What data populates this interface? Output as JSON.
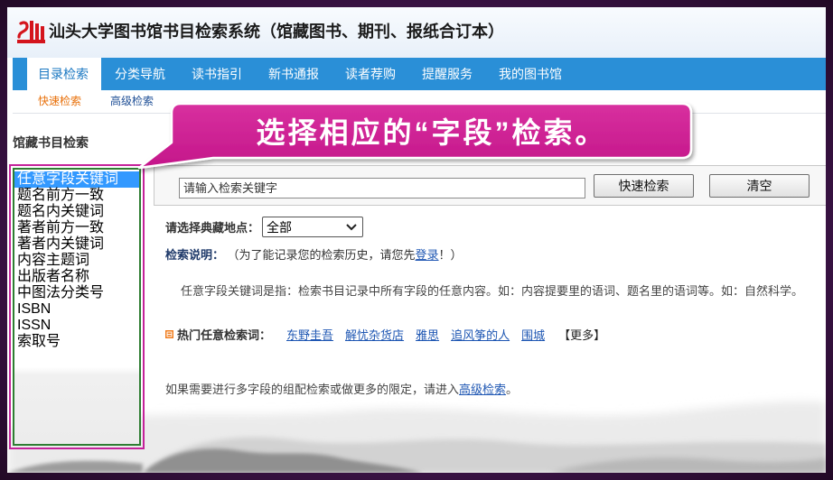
{
  "colors": {
    "frame_bg": "#3b1346",
    "nav_bg": "#2a8fd7",
    "tab_active_text": "#1b78c2",
    "accent_orange": "#e8700a",
    "link_blue": "#1f57b3",
    "callout_fill": "#c4168a",
    "highlight_border": "#c4229a",
    "list_border": "#2e7d32",
    "list_selected": "#3399ff"
  },
  "icons": {
    "logo": "shantou-university-logo",
    "select_arrow": "chevron-down-icon",
    "hot_bullet": "square-bullet-icon"
  },
  "header": {
    "title": "汕头大学图书馆书目检索系统（馆藏图书、期刊、报纸合订本）"
  },
  "nav": {
    "items": [
      {
        "label": "目录检索",
        "active": true
      },
      {
        "label": "分类导航",
        "active": false
      },
      {
        "label": "读书指引",
        "active": false
      },
      {
        "label": "新书通报",
        "active": false
      },
      {
        "label": "读者荐购",
        "active": false
      },
      {
        "label": "提醒服务",
        "active": false
      },
      {
        "label": "我的图书馆",
        "active": false
      }
    ]
  },
  "subnav": {
    "items": [
      {
        "label": "快速检索",
        "active": true
      },
      {
        "label": "高级检索",
        "active": false
      }
    ]
  },
  "sidebar": {
    "title": "馆藏书目检索",
    "selected_index": 0,
    "fields": [
      "任意字段关键词",
      "题名前方一致",
      "题名内关键词",
      "著者前方一致",
      "著者内关键词",
      "内容主题词",
      "出版者名称",
      "中图法分类号",
      "ISBN",
      "ISSN",
      "索取号"
    ]
  },
  "callout": {
    "text": "选择相应的“字段”检索。"
  },
  "search": {
    "placeholder": "请输入检索关键字",
    "submit_label": "快速检索",
    "clear_label": "清空"
  },
  "location": {
    "label": "请选择典藏地点：",
    "selected": "全部"
  },
  "notice": {
    "label": "检索说明：",
    "text_before": "（为了能记录您的检索历史，请您先",
    "link": "登录",
    "text_after": "！）"
  },
  "description": "任意字段关键词是指：检索书目记录中所有字段的任意内容。如：内容提要里的语词、题名里的语词等。如：自然科学。",
  "hot": {
    "label": "热门任意检索词：",
    "keywords": [
      "东野圭吾",
      "解忧杂货店",
      "雅思",
      "追风筝的人",
      "围城"
    ],
    "more": "【更多】"
  },
  "advanced": {
    "text_before": "如果需要进行多字段的组配检索或做更多的限定，请进入",
    "link": "高级检索",
    "text_after": "。"
  }
}
